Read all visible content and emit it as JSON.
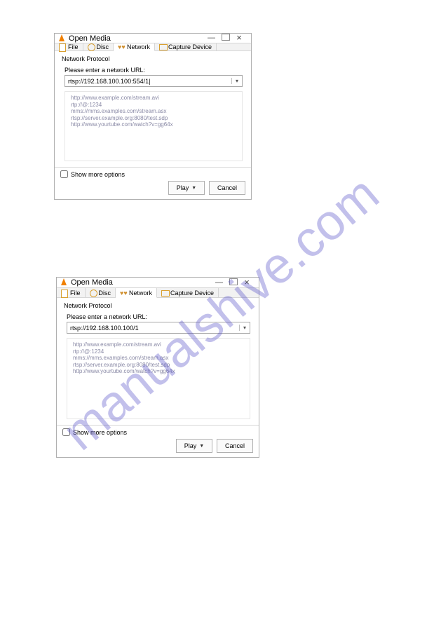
{
  "watermark": "manualshive.com",
  "window_title": "Open Media",
  "tabs": {
    "file": "File",
    "disc": "Disc",
    "network": "Network",
    "capture": "Capture Device"
  },
  "panel": {
    "section_title": "Network Protocol",
    "prompt": "Please enter a network URL:",
    "examples": {
      "e1": "http://www.example.com/stream.avi",
      "e2": "rtp://@:1234",
      "e3": "mms://mms.examples.com/stream.asx",
      "e4": "rtsp://server.example.org:8080/test.sdp",
      "e5": "http://www.yourtube.com/watch?v=gg64x"
    }
  },
  "dialog1": {
    "url_value": "rtsp://192.168.100.100:554/1|"
  },
  "dialog2": {
    "url_value": "rtsp://192.168.100.100/1"
  },
  "show_more_label": "Show more options",
  "play_label": "Play",
  "cancel_label": "Cancel"
}
